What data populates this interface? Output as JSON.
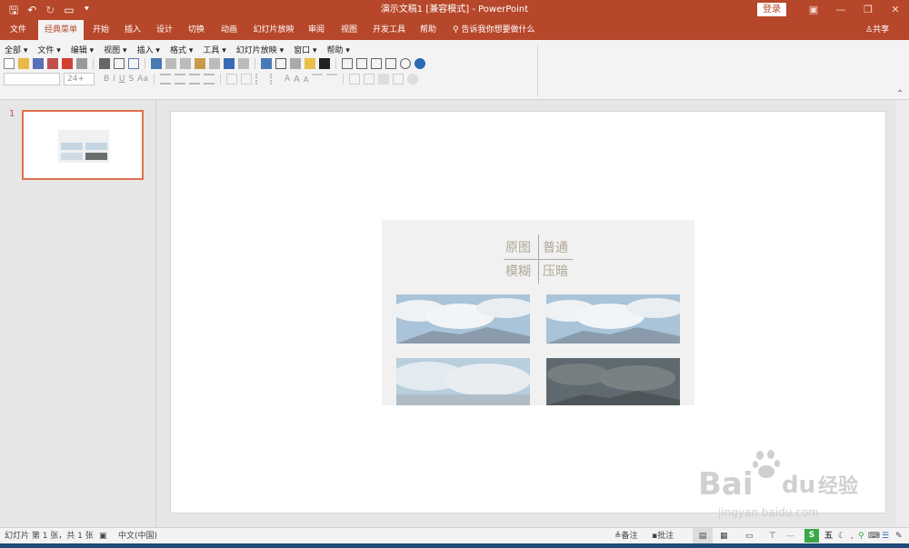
{
  "window": {
    "title": "演示文稿1 [兼容模式] - PowerPoint",
    "login_label": "登录",
    "share_label": "共享"
  },
  "tabs": [
    {
      "label": "文件"
    },
    {
      "label": "经典菜单"
    },
    {
      "label": "开始"
    },
    {
      "label": "插入"
    },
    {
      "label": "设计"
    },
    {
      "label": "切换"
    },
    {
      "label": "动画"
    },
    {
      "label": "幻灯片放映"
    },
    {
      "label": "审阅"
    },
    {
      "label": "视图"
    },
    {
      "label": "开发工具"
    },
    {
      "label": "帮助"
    }
  ],
  "tellme": "告诉我你想要做什么",
  "classic_menu": [
    "全部 ▾",
    "文件 ▾",
    "编辑 ▾",
    "视图 ▾",
    "插入 ▾",
    "格式 ▾",
    "工具 ▾",
    "幻灯片放映 ▾",
    "窗口 ▾",
    "帮助 ▾"
  ],
  "font": {
    "name_value": "",
    "size_value": "24+"
  },
  "thumbnails": [
    {
      "number": "1"
    }
  ],
  "slide": {
    "labels": {
      "top_left": "原图",
      "top_right": "普通",
      "bottom_left": "模糊",
      "bottom_right": "压暗"
    }
  },
  "watermark": {
    "brand": "Bai",
    "brand2": "du",
    "cn": "经验",
    "url": "jingyan.baidu.com"
  },
  "status": {
    "slide_info": "幻灯片 第 1 张，共 1 张",
    "language": "中文(中国)",
    "notes": "备注",
    "comments": "批注",
    "ime": "五"
  },
  "colors": {
    "accent": "#b7472a",
    "selection": "#e07050"
  }
}
